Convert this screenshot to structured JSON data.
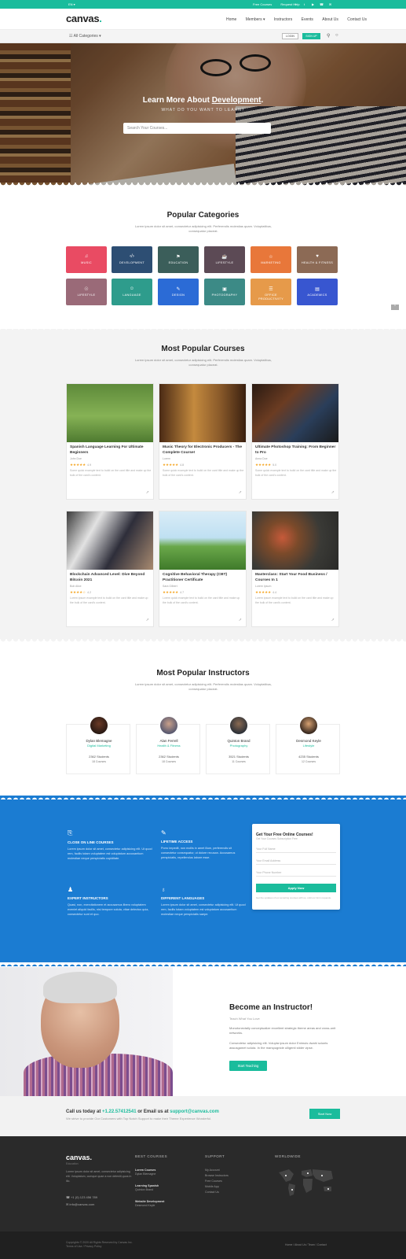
{
  "topbar": {
    "lang": "EN ▾",
    "links": [
      "Free Courses",
      "Request Help"
    ],
    "social": [
      "f",
      "t",
      "▶",
      "☎",
      "✉"
    ]
  },
  "header": {
    "logo_text": "canvas",
    "logo_dot": ".",
    "nav": [
      "Home",
      "Members ▾",
      "Instructors",
      "Events",
      "About Us",
      "Contact Us"
    ]
  },
  "subbar": {
    "categories": "☷ All Categories ▾",
    "login": "LOGIN",
    "signup": "SIGN UP"
  },
  "hero": {
    "title_prefix": "Learn More About ",
    "title_highlight": "Development",
    "title_suffix": ".",
    "subtitle": "WHAT DO YOU WANT TO LEARN?",
    "search_placeholder": "Search Your Courses..."
  },
  "categories": {
    "title": "Popular Categories",
    "subtitle": "Lorem ipsum dolor sit amet, consectetur adipisicing elit. Perferendis molestias quam. Voluptatibus, consequatur placeat.",
    "items": [
      {
        "label": "Music",
        "icon": "♫",
        "color": "#e94b63"
      },
      {
        "label": "Development",
        "icon": "‹/›",
        "color": "#2d4e73"
      },
      {
        "label": "Education",
        "icon": "⚑",
        "color": "#3b5e5a"
      },
      {
        "label": "Lifestyle",
        "icon": "☕",
        "color": "#5c4a55"
      },
      {
        "label": "Marketing",
        "icon": "☆",
        "color": "#e8773a"
      },
      {
        "label": "Health & Fitness",
        "icon": "♥",
        "color": "#8c6a55"
      },
      {
        "label": "Lifestyle",
        "icon": "☉",
        "color": "#9a6a78"
      },
      {
        "label": "Language",
        "icon": "☺",
        "color": "#2e9c8c"
      },
      {
        "label": "Design",
        "icon": "✎",
        "color": "#2b6bd6"
      },
      {
        "label": "Photography",
        "icon": "▣",
        "color": "#3c8a86"
      },
      {
        "label": "Office Productivity",
        "icon": "☰",
        "color": "#e69a4a"
      },
      {
        "label": "Academics",
        "icon": "▤",
        "color": "#3856d0"
      }
    ]
  },
  "courses": {
    "title": "Most Popular Courses",
    "subtitle": "Lorem ipsum dolor sit amet, consectetur adipisicing elit. Perferendis molestias quam. Voluptatibus, consequatur placeat.",
    "items": [
      {
        "title": "Spanish Language Learning For Ultimate Beginners",
        "author": "John Doe",
        "stars": "★★★★★",
        "rating": "4.9",
        "desc": "Some quick example text to build on the card title and make up the bulk of the card's content.",
        "img": "linear-gradient(180deg,#5d8a3a 0%,#86b255 55%,#4e7a30 100%)"
      },
      {
        "title": "Music Theory for Electronic Producers - The Complete Course!",
        "author": "Lorem",
        "stars": "★★★★★",
        "rating": "4.8",
        "desc": "Some quick example text to build on the card title and make up the bulk of the card's content.",
        "img": "linear-gradient(90deg,#4a2a15 0%,#c48a3e 40%,#8a5a2a 70%,#3a2010 100%)"
      },
      {
        "title": "Ultimate Photoshop Training: From Beginner to Pro",
        "author": "Anna Doe",
        "stars": "★★★★★",
        "rating": "5.0",
        "desc": "Some quick example text to build on the card title and make up the bulk of the card's content.",
        "img": "linear-gradient(135deg,#2a1a12 0%,#6b3c22 35%,#2a3e5a 65%,#1a1a1a 100%)"
      },
      {
        "title": "Blockchain Advanced Level: Dive Beyond Bitcoin 2021",
        "author": "Bob Alice",
        "stars": "★★★★☆",
        "rating": "4.2",
        "desc": "Lorem ipsum example text to build on the card title and make up the bulk of the card's content.",
        "img": "linear-gradient(120deg,#3a3a3a 0%,#e2e2e2 30%,#2e2e3a 60%,#a88a70 100%)"
      },
      {
        "title": "Cognitive Behavioral Therapy (CBT) Practitioner Certificate",
        "author": "Sara Gilbert",
        "stars": "★★★★★",
        "rating": "4.7",
        "desc": "Lorem quick example text to build on the card title and make up the bulk of the card's content.",
        "img": "linear-gradient(180deg,#d9ecf7 0%,#bfe0f2 45%,#6aa84a 60%,#3f7a2a 100%)"
      },
      {
        "title": "Masterclass: Start Your Food Business / Courses In 1",
        "author": "Lorem Ipsum",
        "stars": "★★★★★",
        "rating": "4.4",
        "desc": "Lorem ipsum example text to build on the card title and make up the bulk of the card's content.",
        "img": "radial-gradient(circle at 35% 45%,#c65a3a 0%,#7b4a2a 25%,#3a3a36 60%,#2a2a28 100%)"
      }
    ]
  },
  "instructors": {
    "title": "Most Popular Instructors",
    "subtitle": "Lorem ipsum dolor sit amet, consectetur adipisicing elit. Perferendis molestias quam. Voluptatibus, consequatur placeat.",
    "items": [
      {
        "name": "Dylan Blemagne",
        "role": "Digital Marketing",
        "students": "2362 Students",
        "courses": "18 Courses",
        "av": "radial-gradient(circle at 50% 40%,#6b3a26 0%,#2a1a14 70%)"
      },
      {
        "name": "Alan Ferrell",
        "role": "Health & Fitness",
        "students": "2362 Students",
        "courses": "18 Courses",
        "av": "radial-gradient(circle at 50% 40%,#c9a08a 0%,#5a5a70 70%)"
      },
      {
        "name": "Quinton Brand",
        "role": "Photography",
        "students": "3521 Students",
        "courses": "11 Courses",
        "av": "radial-gradient(circle at 50% 40%,#8a6a52 0%,#2e3238 70%)"
      },
      {
        "name": "Desmond Keyle",
        "role": "Lifestyle",
        "students": "4235 Students",
        "courses": "12 Courses",
        "av": "radial-gradient(circle at 50% 40%,#d6a070 0%,#3a2a20 70%)"
      }
    ]
  },
  "features": {
    "items": [
      {
        "icon": "⎘",
        "title": "CLOSE ON LINE COURSES",
        "desc": "Lorem ipsum dolor sit amet, consectetur adipisicing elit. Ut quod rem, facilis totam voluptatem est voluptatum accusantium molestiae neque perspiciatis cupiditate."
      },
      {
        "icon": "✎",
        "title": "LIFETIME ACCESS",
        "desc": "Porro impedit, non mollis in amet illum, perferendis sit consectetur consequatur, ut dolore recusan. Accusamus perspiciatis, repellendus labore esse."
      },
      {
        "icon": "♟",
        "title": "EXPERT INSTRUCTORS",
        "desc": "Quasi, non, exercitationem et accusamus libero voluptatem eveniet aliquid facilis, nisi tempore soluta, vitae delectus quia, consectetur sunt et quo."
      },
      {
        "icon": "♁",
        "title": "DIFFERENT LANGUAGES",
        "desc": "Lorem ipsum dolor sit amet, consectetur adipisicing elit. Ut quod rem, facilis totam voluptatem est voluptatum accusantium molestiae neque perspiciatis saepe."
      }
    ],
    "form": {
      "title": "Get Your Free Online Courses!",
      "subtitle": "Get Your Courses Subscription Free",
      "fields": [
        "Your Full Name",
        "Your Email Address",
        "Your Phone Number"
      ],
      "button": "Apply Now",
      "note": "Get the updates of our amazing courses with us, until our form requests."
    }
  },
  "become": {
    "title": "Become an Instructor!",
    "tag": "Teach What You Love",
    "p1": "Monotonectally conceptualize excellent strategic theme areas and cross-unit networks.",
    "p2": "Consectetur adipisicing elit. Volupta ipsum dolor Enimuis dwahi sciunts assusgamet soluta. In the marspugnide ulligenti stider vipse.",
    "button": "Start Teaching"
  },
  "cta": {
    "prefix": "Call us today at ",
    "phone": "+1.22.57412541",
    "middle": " or Email us at ",
    "email": "support@canvas.com",
    "sub": "We strive to provide Our Customers with Top Notch Support to make their Theme Experience Wonderful.",
    "button": "Start Now"
  },
  "footer": {
    "logo": "canvas.",
    "tagline": "Education",
    "desc": "Lorem ipsum dolor sit amet, consectetur adipisicing elit. Voluptatum, cumque quae a non deleniti,quos in illo.",
    "phone": "☎ +1 (0) 123 456 789",
    "email": "✉ info@canvas.com",
    "col1_title": "BEST COURSES",
    "col1": [
      {
        "t": "Lorem Courses",
        "s": "Dylan Blemagne"
      },
      {
        "t": "Learning Spanish",
        "s": "Quinton Brand"
      },
      {
        "t": "Website Development",
        "s": "Desmond Keyle"
      }
    ],
    "col2_title": "SUPPORT",
    "col2": [
      "My Account",
      "Browse Instructors",
      "Free Courses",
      "Mobile App",
      "Contact Us"
    ],
    "col3_title": "WORLDWIDE"
  },
  "copyright": {
    "line1": "Copyrights © 2020 All Rights Reserved by Canvas Inc.",
    "line2": "Terms of Use / Privacy Policy",
    "links": "Home  /  About Us  /  Team  /  Contact"
  }
}
